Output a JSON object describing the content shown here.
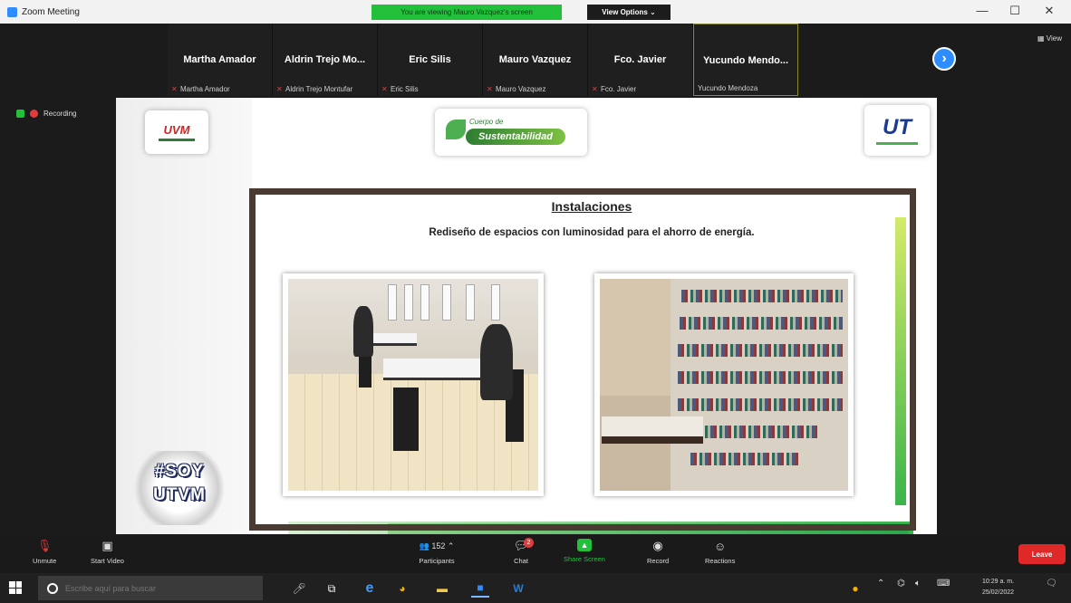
{
  "window": {
    "title": "Zoom Meeting",
    "share_banner": "You are viewing Mauro Vazquez's screen",
    "view_options": "View Options ⌄",
    "minimize": "—",
    "maximize": "☐",
    "close": "✕"
  },
  "participants": [
    {
      "display": "Martha Amador",
      "name": "Martha Amador",
      "muted": true
    },
    {
      "display": "Aldrin Trejo Mo...",
      "name": "Aldrin Trejo Montufar",
      "muted": true
    },
    {
      "display": "Eric Silis",
      "name": "Eric Silis",
      "muted": true
    },
    {
      "display": "Mauro Vazquez",
      "name": "Mauro Vazquez",
      "muted": true
    },
    {
      "display": "Fco. Javier",
      "name": "Fco. Javier",
      "muted": true
    },
    {
      "display": "Yucundo Mendo...",
      "name": "Yucundo Mendoza",
      "muted": false
    }
  ],
  "view_label": "View",
  "status": {
    "recording": "Recording"
  },
  "slide": {
    "logo_left": "UVM",
    "logo_center_top": "Cuerpo de",
    "logo_center_main": "Sustentabilidad",
    "logo_right": "UT",
    "title": "Instalaciones",
    "subtitle": "Rediseño de espacios con luminosidad para el ahorro de energía.",
    "badge_line1": "#SOY",
    "badge_line2": "UTVM"
  },
  "toolbar": {
    "unmute": "Unmute",
    "start_video": "Start Video",
    "participants": "Participants",
    "participant_count": "152",
    "chat": "Chat",
    "chat_badge": "2",
    "share_screen": "Share Screen",
    "record": "Record",
    "reactions": "Reactions",
    "leave": "Leave"
  },
  "taskbar": {
    "search_placeholder": "Escribe aquí para buscar",
    "time": "10:29 a. m.",
    "date": "25/02/2022"
  },
  "colors": {
    "zoom_blue": "#2d8cff",
    "share_green": "#23c03b",
    "leave_red": "#e02828"
  }
}
